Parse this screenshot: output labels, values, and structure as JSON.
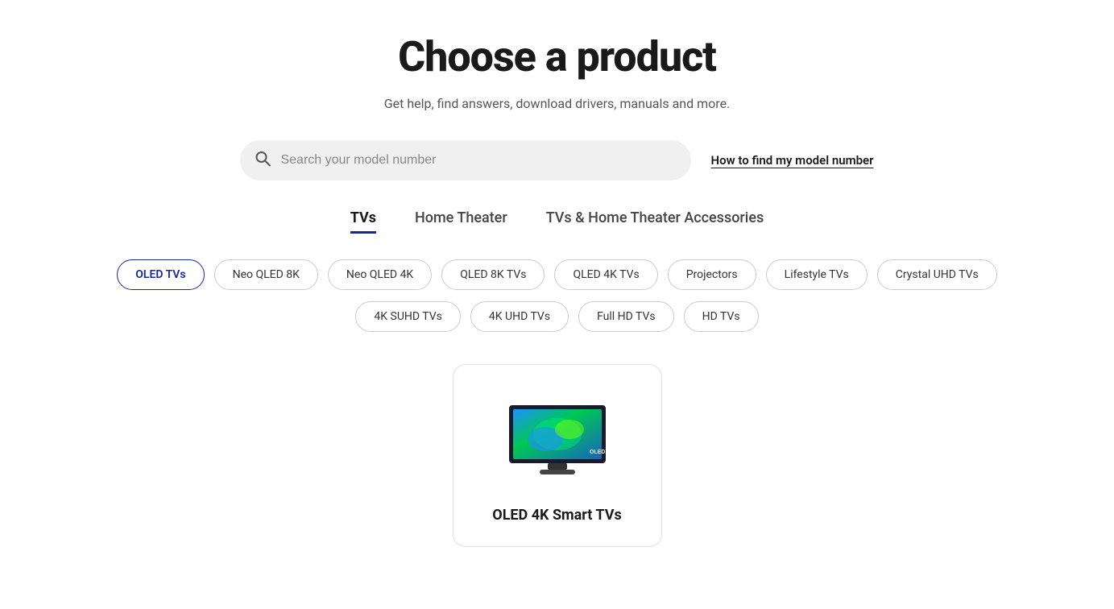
{
  "header": {
    "title": "Choose a product",
    "subtitle": "Get help, find answers, download drivers, manuals and more."
  },
  "search": {
    "placeholder": "Search your model number",
    "find_model_link": "How to find my model number"
  },
  "tabs": [
    {
      "label": "TVs",
      "active": true
    },
    {
      "label": "Home Theater",
      "active": false
    },
    {
      "label": "TVs & Home Theater Accessories",
      "active": false
    }
  ],
  "filters_row1": [
    {
      "label": "OLED TVs",
      "active": true
    },
    {
      "label": "Neo QLED 8K",
      "active": false
    },
    {
      "label": "Neo QLED 4K",
      "active": false
    },
    {
      "label": "QLED 8K TVs",
      "active": false
    },
    {
      "label": "QLED 4K TVs",
      "active": false
    },
    {
      "label": "Projectors",
      "active": false
    },
    {
      "label": "Lifestyle TVs",
      "active": false
    },
    {
      "label": "Crystal UHD TVs",
      "active": false
    }
  ],
  "filters_row2": [
    {
      "label": "4K SUHD TVs",
      "active": false
    },
    {
      "label": "4K UHD TVs",
      "active": false
    },
    {
      "label": "Full HD TVs",
      "active": false
    },
    {
      "label": "HD TVs",
      "active": false
    }
  ],
  "product_card": {
    "title": "OLED 4K Smart TVs"
  },
  "colors": {
    "accent": "#1428A0"
  }
}
